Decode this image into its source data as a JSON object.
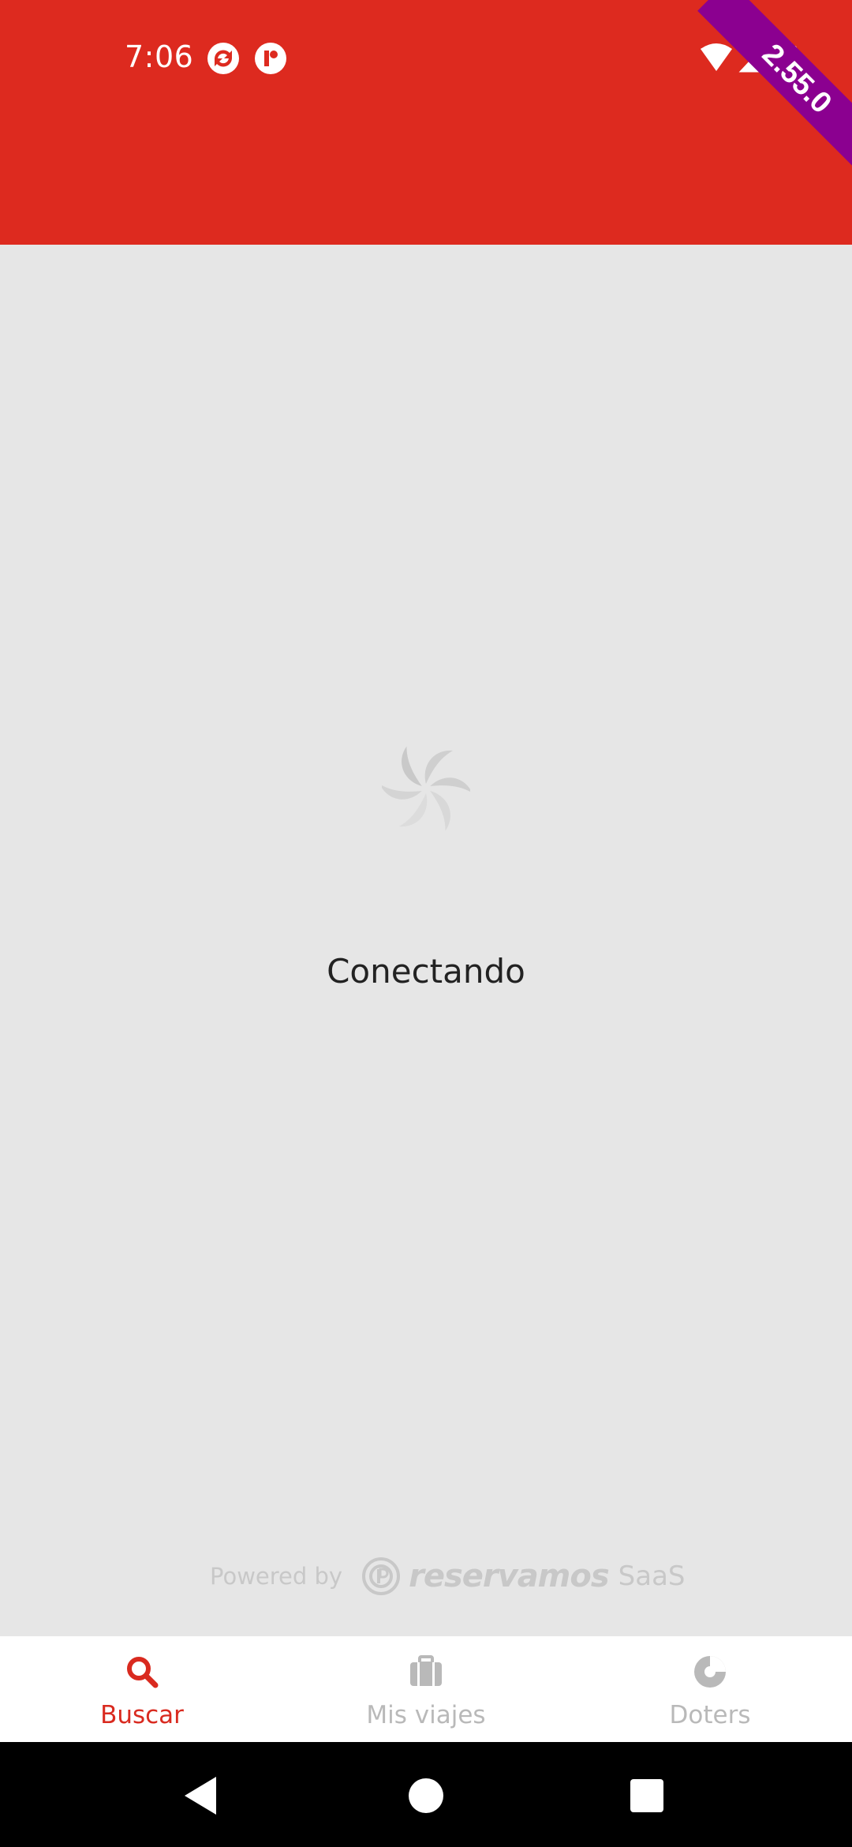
{
  "status_bar": {
    "time": "7:06"
  },
  "version_ribbon": {
    "label": "2.55.0",
    "color": "#8b0090"
  },
  "theme": {
    "header_color": "#dd2a1f",
    "accent": "#d92a1f",
    "background": "#e6e6e6",
    "inactive": "#b9b9b9"
  },
  "main": {
    "loading_icon": "spinner-icon",
    "status_text": "Conectando"
  },
  "footer": {
    "powered_label": "Powered by",
    "brand_name": "reservamos",
    "brand_suffix": "SaaS"
  },
  "bottom_nav": {
    "items": [
      {
        "label": "Buscar",
        "icon": "search-icon",
        "active": true
      },
      {
        "label": "Mis viajes",
        "icon": "briefcase-icon",
        "active": false
      },
      {
        "label": "Doters",
        "icon": "doters-icon",
        "active": false
      }
    ]
  },
  "system_nav": {
    "buttons": [
      "back-icon",
      "home-icon",
      "recents-icon"
    ]
  }
}
